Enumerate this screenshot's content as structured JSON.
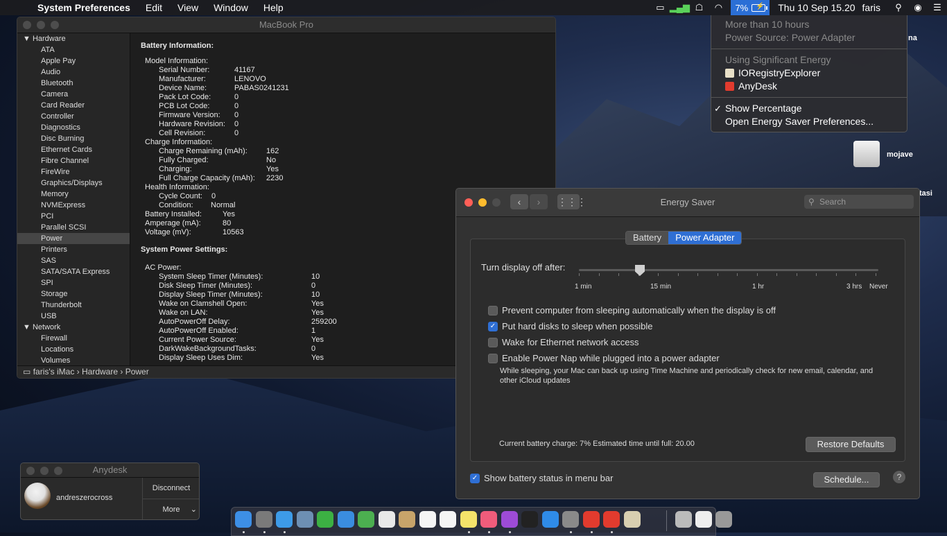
{
  "menubar": {
    "apple": "",
    "app_name": "System Preferences",
    "menus": [
      "Edit",
      "View",
      "Window",
      "Help"
    ],
    "battery_percent": "7%",
    "clock": "Thu 10 Sep  15.20",
    "user": "faris"
  },
  "battery_menu": {
    "time_remaining": "More than 10 hours",
    "power_source": "Power Source: Power Adapter",
    "significant_energy_header": "Using Significant Energy",
    "apps": [
      "IORegistryExplorer",
      "AnyDesk"
    ],
    "show_percentage": "Show Percentage",
    "open_prefs": "Open Energy Saver Preferences..."
  },
  "sysinfo": {
    "title": "MacBook Pro",
    "sidebar": {
      "hardware_label": "Hardware",
      "hardware_items": [
        "ATA",
        "Apple Pay",
        "Audio",
        "Bluetooth",
        "Camera",
        "Card Reader",
        "Controller",
        "Diagnostics",
        "Disc Burning",
        "Ethernet Cards",
        "Fibre Channel",
        "FireWire",
        "Graphics/Displays",
        "Memory",
        "NVMExpress",
        "PCI",
        "Parallel SCSI",
        "Power",
        "Printers",
        "SAS",
        "SATA/SATA Express",
        "SPI",
        "Storage",
        "Thunderbolt",
        "USB"
      ],
      "network_label": "Network",
      "network_items": [
        "Firewall",
        "Locations",
        "Volumes"
      ]
    },
    "battery_heading": "Battery Information:",
    "model_heading": "Model Information:",
    "model_rows": [
      [
        "Serial Number:",
        "41167"
      ],
      [
        "Manufacturer:",
        "LENOVO"
      ],
      [
        "Device Name:",
        "PABAS0241231"
      ],
      [
        "Pack Lot Code:",
        "0"
      ],
      [
        "PCB Lot Code:",
        "0"
      ],
      [
        "Firmware Version:",
        "0"
      ],
      [
        "Hardware Revision:",
        "0"
      ],
      [
        "Cell Revision:",
        "0"
      ]
    ],
    "charge_heading": "Charge Information:",
    "charge_rows": [
      [
        "Charge Remaining (mAh):",
        "162"
      ],
      [
        "Fully Charged:",
        "No"
      ],
      [
        "Charging:",
        "Yes"
      ],
      [
        "Full Charge Capacity (mAh):",
        "2230"
      ]
    ],
    "health_heading": "Health Information:",
    "health_rows": [
      [
        "Cycle Count:",
        "0"
      ],
      [
        "Condition:",
        "Normal"
      ]
    ],
    "battery_rows": [
      [
        "Battery Installed:",
        "Yes"
      ],
      [
        "Amperage (mA):",
        "80"
      ],
      [
        "Voltage (mV):",
        "10563"
      ]
    ],
    "power_heading": "System Power Settings:",
    "ac_heading": "AC Power:",
    "ac_rows": [
      [
        "System Sleep Timer (Minutes):",
        "10"
      ],
      [
        "Disk Sleep Timer (Minutes):",
        "0"
      ],
      [
        "Display Sleep Timer (Minutes):",
        "10"
      ],
      [
        "Wake on Clamshell Open:",
        "Yes"
      ],
      [
        "Wake on LAN:",
        "Yes"
      ],
      [
        "AutoPowerOff Delay:",
        "259200"
      ],
      [
        "AutoPowerOff Enabled:",
        "1"
      ],
      [
        "Current Power Source:",
        "Yes"
      ],
      [
        "DarkWakeBackgroundTasks:",
        "0"
      ],
      [
        "Display Sleep Uses Dim:",
        "Yes"
      ]
    ],
    "path": [
      "faris's iMac",
      "Hardware",
      "Power"
    ]
  },
  "energy": {
    "title": "Energy Saver",
    "search_placeholder": "Search",
    "tab_battery": "Battery",
    "tab_adapter": "Power Adapter",
    "slider_label": "Turn display off after:",
    "slider_ticks": [
      "1 min",
      "15 min",
      "1 hr",
      "3 hrs",
      "Never"
    ],
    "display_off_value": "15 min",
    "opt_prevent": "Prevent computer from sleeping automatically when the display is off",
    "opt_prevent_checked": false,
    "opt_disks": "Put hard disks to sleep when possible",
    "opt_disks_checked": true,
    "opt_wake": "Wake for Ethernet network access",
    "opt_wake_checked": false,
    "opt_nap": "Enable Power Nap while plugged into a power adapter",
    "opt_nap_checked": false,
    "nap_note": "While sleeping, your Mac can back up using Time Machine and periodically check for new email, calendar, and other iCloud updates",
    "charge_status": "Current battery charge: 7% Estimated time until full: 20.00",
    "restore_btn": "Restore Defaults",
    "show_status": "Show battery status in menu bar",
    "show_status_checked": true,
    "schedule_btn": "Schedule...",
    "help": "?"
  },
  "anydesk": {
    "title": "Anydesk",
    "user": "andreszerocross",
    "disconnect": "Disconnect",
    "more": "More"
  },
  "desktop": {
    "disk_label": "mojave",
    "label_partial_1": "na",
    "label_partial_2": "tasi"
  },
  "colors": {
    "accent": "#2f6fd4",
    "close": "#ff5f57",
    "minimize": "#febc2e",
    "zoom": "#28c840"
  }
}
